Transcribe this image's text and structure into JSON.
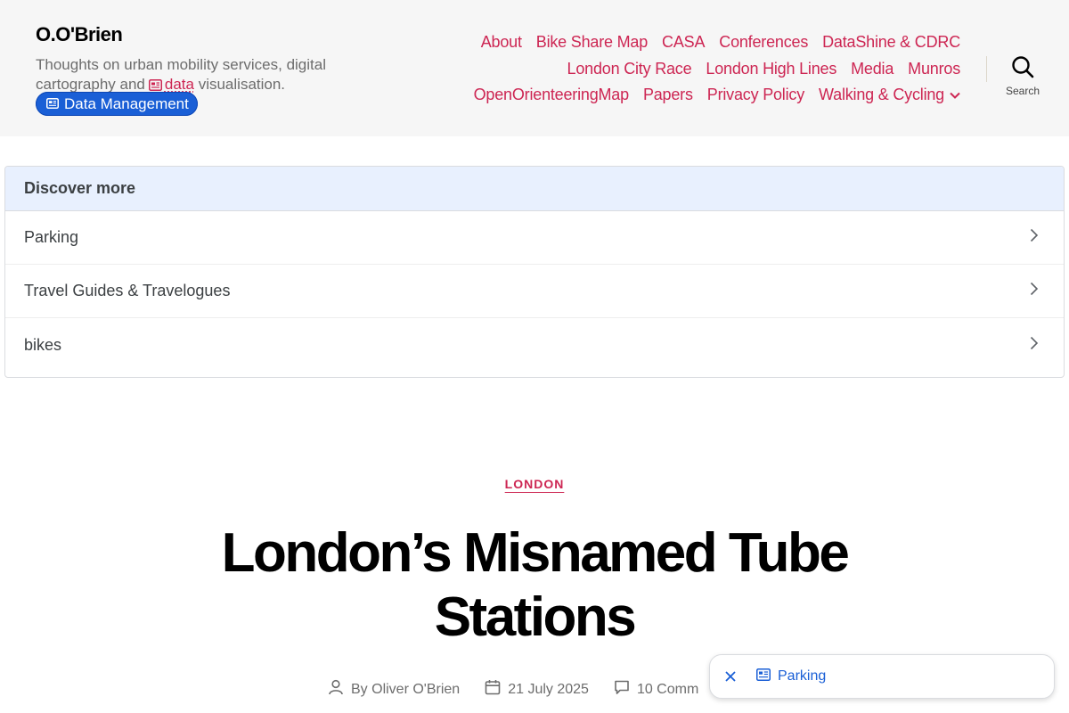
{
  "header": {
    "site_title": "O.O'Brien",
    "tagline_part1": "Thoughts on urban mobility services, digital cartography and",
    "tagline_link": "data",
    "tagline_part2": "visualisation.",
    "pill_label": "Data Management",
    "search_label": "Search"
  },
  "nav": {
    "row1": [
      "About",
      "Bike Share Map",
      "CASA",
      "Conferences",
      "DataShine & CDRC"
    ],
    "row2": [
      "London City Race",
      "London High Lines",
      "Media",
      "Munros"
    ],
    "row3": [
      "OpenOrienteeringMap",
      "Papers",
      "Privacy Policy",
      "Walking & Cycling"
    ]
  },
  "discover": {
    "heading": "Discover more",
    "items": [
      "Parking",
      "Travel Guides & Travelogues",
      "bikes"
    ]
  },
  "article": {
    "category": "LONDON",
    "title": "London’s Misnamed Tube Stations",
    "author": "By Oliver O'Brien",
    "date": "21 July 2025",
    "comments": "10 Comm"
  },
  "chip": {
    "label": "Parking"
  },
  "colors": {
    "accent": "#cd2653",
    "pill_blue": "#1a5fd6",
    "header_bg": "#f6f6f6",
    "discover_head_bg": "#e8f0fe"
  }
}
